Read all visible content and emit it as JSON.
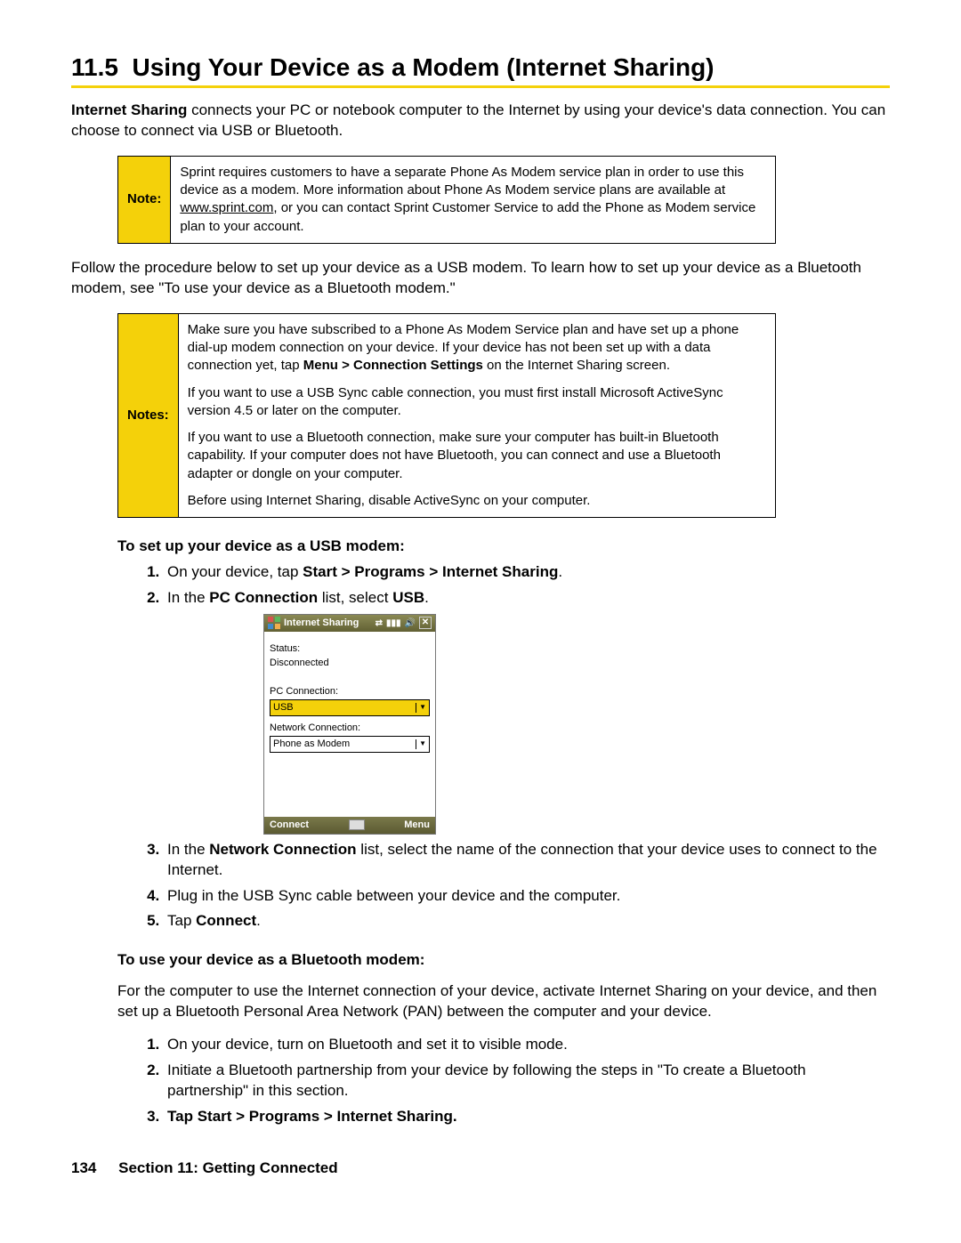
{
  "section": {
    "number": "11.5",
    "title": "Using Your Device as a Modem (Internet Sharing)"
  },
  "intro": {
    "lead_bold": "Internet Sharing",
    "lead_rest": " connects your PC or notebook computer to the Internet by using your device's data connection. You can choose to connect via USB or Bluetooth."
  },
  "note1": {
    "label": "Note:",
    "text_pre": "Sprint requires customers to have a separate Phone As Modem service plan in order to use this device as a modem. More information about Phone As Modem service plans are available at ",
    "link": "www.sprint.com",
    "text_post": ", or you can contact Sprint Customer Service to add the Phone as Modem service plan to your account."
  },
  "follow_text": "Follow the procedure below to set up your device as a USB modem. To learn how to set up your device as a Bluetooth modem, see \"To use your device as a Bluetooth modem.\"",
  "notes2": {
    "label": "Notes:",
    "p1_pre": "Make sure you have subscribed to a Phone As Modem Service plan and have set up a phone dial-up modem connection on your device. If your device has not been set up with a data connection yet, tap ",
    "p1_bold": "Menu > Connection Settings",
    "p1_post": " on the Internet Sharing screen.",
    "p2": "If you want to use a USB Sync cable connection, you must first install Microsoft ActiveSync version 4.5 or later on the computer.",
    "p3": "If you want to use a Bluetooth connection, make sure your computer has built-in Bluetooth capability. If your computer does not have Bluetooth, you can connect and use a Bluetooth adapter or dongle on your computer.",
    "p4": "Before using Internet Sharing, disable ActiveSync on your computer."
  },
  "usb": {
    "heading": "To set up your device as a USB modem:",
    "step1_pre": "On your device, tap ",
    "step1_bold": "Start > Programs > Internet Sharing",
    "step1_post": ".",
    "step2_pre": "In the ",
    "step2_bold1": "PC Connection",
    "step2_mid": " list, select ",
    "step2_bold2": "USB",
    "step2_post": ".",
    "step3_pre": "In the ",
    "step3_bold": "Network Connection",
    "step3_post": " list, select the name of the connection that your device uses to connect to the Internet.",
    "step4": "Plug in the USB Sync cable between your device and the computer.",
    "step5_pre": "Tap ",
    "step5_bold": "Connect",
    "step5_post": "."
  },
  "phone": {
    "title": "Internet Sharing",
    "status_label": "Status:",
    "status_value": "Disconnected",
    "pc_label": "PC Connection:",
    "pc_value": "USB",
    "net_label": "Network Connection:",
    "net_value": "Phone as Modem",
    "soft_left": "Connect",
    "soft_right": "Menu"
  },
  "bt": {
    "heading": "To use your device as a Bluetooth modem:",
    "intro": "For the computer to use the Internet connection of your device, activate Internet Sharing on your device, and then set up a Bluetooth Personal Area Network (PAN) between the computer and your device.",
    "step1": "On your device, turn on Bluetooth and set it to visible mode.",
    "step2": "Initiate a Bluetooth partnership from your device by following the steps in \"To create a Bluetooth partnership\" in this section.",
    "step3_pre": "Tap ",
    "step3_bold": "Start > Programs > Internet Sharing",
    "step3_post": "."
  },
  "footer": {
    "page": "134",
    "section": "Section 11: Getting Connected"
  }
}
